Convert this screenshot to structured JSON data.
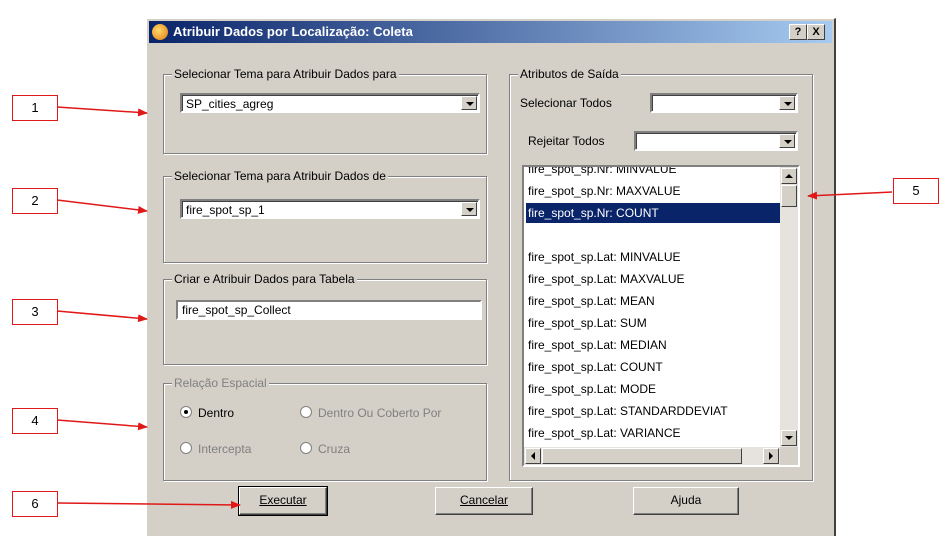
{
  "dialog": {
    "title": "Atribuir Dados por Localização: Coleta",
    "help_button": "?",
    "close_button": "X"
  },
  "group_target": {
    "legend": "Selecionar Tema para Atribuir Dados para",
    "selected": "SP_cities_agreg"
  },
  "group_source": {
    "legend": "Selecionar Tema para Atribuir Dados de",
    "selected": "fire_spot_sp_1"
  },
  "group_table": {
    "legend": "Criar e Atribuir Dados para Tabela",
    "value": "fire_spot_sp_Collect"
  },
  "group_spatial": {
    "legend": "Relação Espacial",
    "options": [
      "Dentro",
      "Dentro Ou Coberto Por",
      "Intercepta",
      "Cruza"
    ],
    "selected": "Dentro"
  },
  "group_output": {
    "legend": "Atributos de Saída",
    "select_all_label": "Selecionar Todos",
    "select_all_value": "",
    "reject_all_label": "Rejeitar Todos",
    "reject_all_value": "",
    "items": [
      "fire_spot_sp.Nr: MINVALUE",
      "fire_spot_sp.Nr: MAXVALUE",
      "fire_spot_sp.Nr: COUNT",
      "",
      "fire_spot_sp.Lat: MINVALUE",
      "fire_spot_sp.Lat: MAXVALUE",
      "fire_spot_sp.Lat: MEAN",
      "fire_spot_sp.Lat: SUM",
      "fire_spot_sp.Lat: MEDIAN",
      "fire_spot_sp.Lat: COUNT",
      "fire_spot_sp.Lat: MODE",
      "fire_spot_sp.Lat: STANDARDDEVIAT",
      "fire_spot_sp.Lat: VARIANCE"
    ],
    "selected_item": "fire_spot_sp.Nr: COUNT"
  },
  "buttons": {
    "execute": "Executar",
    "cancel": "Cancelar",
    "help": "Ajuda"
  },
  "callouts": [
    "1",
    "2",
    "3",
    "4",
    "5",
    "6"
  ],
  "colors": {
    "title_gradient_start": "#0a246a",
    "title_gradient_end": "#a6caf0",
    "callout_border": "#e01818",
    "arrow": "#e01818",
    "selection": "#0a246a"
  }
}
